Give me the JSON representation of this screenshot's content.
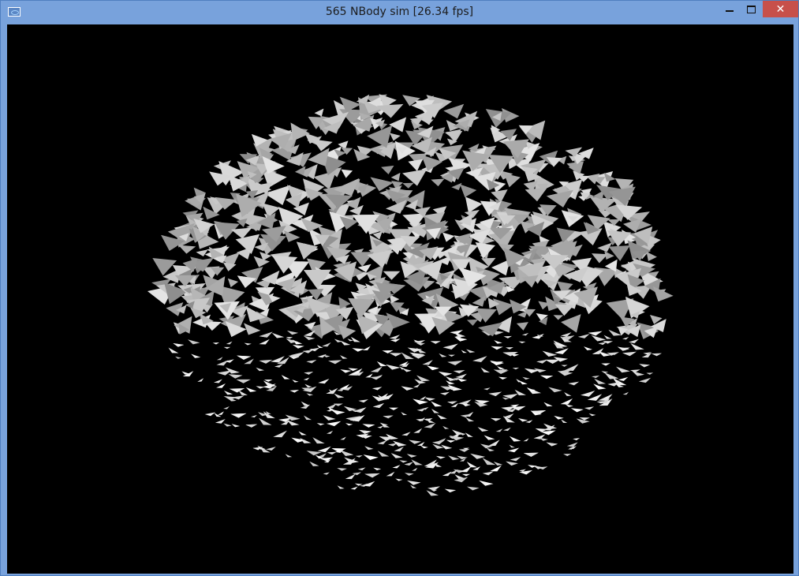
{
  "window": {
    "title": "565 NBody sim [26.34 fps]",
    "controls": {
      "minimize": "minimize",
      "maximize": "maximize",
      "close": "✕"
    }
  },
  "icons": {
    "app": "app-window-icon",
    "minimize": "minimize-icon",
    "maximize": "maximize-icon",
    "close": "close-icon"
  },
  "colors": {
    "titlebar": "#78a2dc",
    "close_button": "#c7504a",
    "viewport_background": "#000000",
    "particle": "#d8d8d8"
  }
}
